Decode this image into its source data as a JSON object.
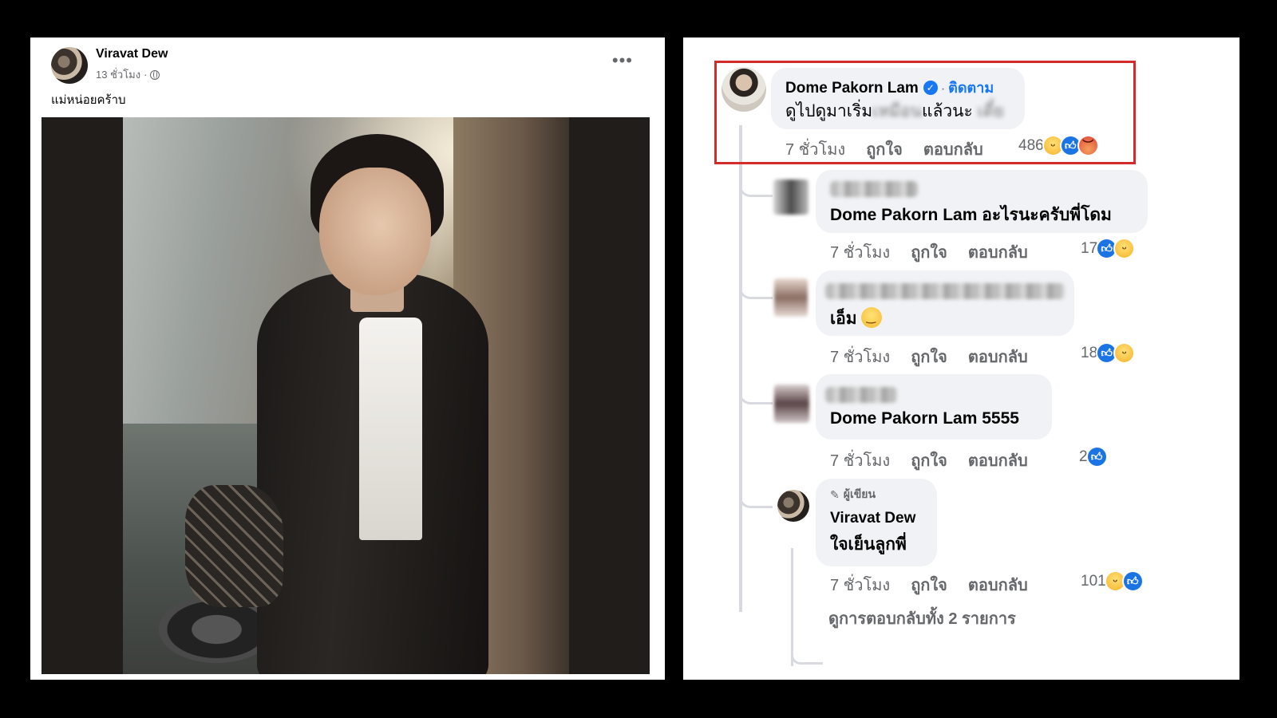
{
  "post": {
    "author": "Viravat Dew",
    "time": "13 ชั่วโมง",
    "separator": "·",
    "caption": "แม่หน่อยคร้าบ",
    "more_label": "•••"
  },
  "comments": {
    "top": {
      "name": "Dome Pakorn Lam",
      "verified_mark": "✓",
      "follow_sep": "·",
      "follow_label": "ติดตาม",
      "text_start": "ดูไปดูมาเริ่ม",
      "text_blurred": "เหมือน",
      "text_mid": "แล้วนะ",
      "text_blurred_end": "เดี๋ย",
      "time": "7 ชั่วโมง",
      "like_label": "ถูกใจ",
      "reply_label": "ตอบกลับ",
      "reaction_count": "486",
      "reactions": [
        "haha",
        "like",
        "angry"
      ]
    },
    "replies": [
      {
        "text": "Dome Pakorn Lam อะไรนะครับพี่โดม",
        "time": "7 ชั่วโมง",
        "like_label": "ถูกใจ",
        "reply_label": "ตอบกลับ",
        "reaction_count": "17",
        "reactions": [
          "like",
          "haha"
        ]
      },
      {
        "text": "เอ็ม",
        "emoji": "smiling-face",
        "time": "7 ชั่วโมง",
        "like_label": "ถูกใจ",
        "reply_label": "ตอบกลับ",
        "reaction_count": "18",
        "reactions": [
          "like",
          "haha"
        ]
      },
      {
        "text": "Dome Pakorn Lam 5555",
        "time": "7 ชั่วโมง",
        "like_label": "ถูกใจ",
        "reply_label": "ตอบกลับ",
        "reaction_count": "2",
        "reactions": [
          "like"
        ]
      },
      {
        "badge": "ผู้เขียน",
        "name": "Viravat Dew",
        "text": "ใจเย็นลูกพี่",
        "time": "7 ชั่วโมง",
        "like_label": "ถูกใจ",
        "reply_label": "ตอบกลับ",
        "reaction_count": "101",
        "reactions": [
          "haha",
          "like"
        ]
      }
    ],
    "view_replies": "ดูการตอบกลับทั้ง 2 รายการ"
  },
  "colors": {
    "highlight": "#d42a2a",
    "facebook_blue": "#1877f2",
    "bubble_bg": "#f0f2f5",
    "secondary_text": "#65676b"
  }
}
